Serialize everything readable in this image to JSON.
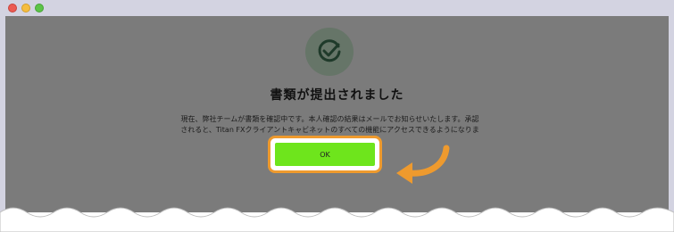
{
  "window": {
    "controls": [
      "close",
      "minimize",
      "zoom"
    ]
  },
  "dialog": {
    "icon": "checkmark-circle-icon",
    "title": "書類が提出されました",
    "description": "現在、弊社チームが書類を確認中です。本人確認の結果はメールでお知らせいたします。承認されると、Titan FXクライアントキャビネットのすべての機能にアクセスできるようになります。",
    "ok_label": "OK"
  },
  "colors": {
    "overlay": "#7b7b7b",
    "button": "#6ee51c",
    "highlight": "#ee9a2e",
    "check": "#1f3a2a"
  }
}
